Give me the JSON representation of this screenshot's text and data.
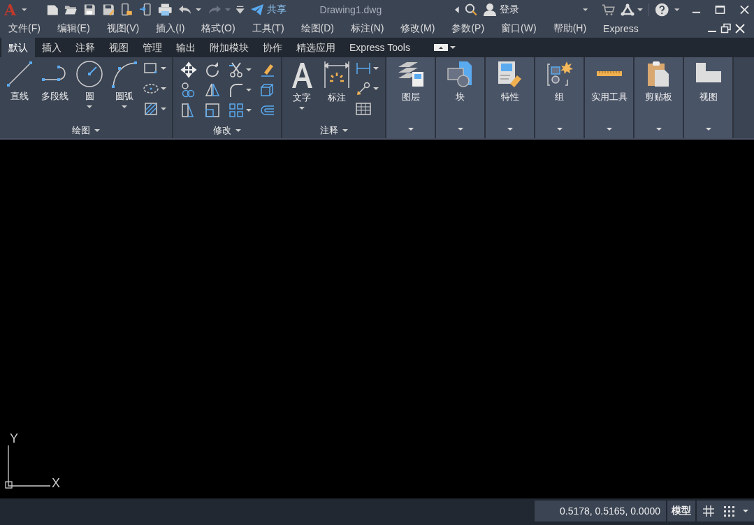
{
  "title_bar": {
    "logo": "A",
    "share": "共享",
    "document_title": "Drawing1.dwg",
    "sign_in": "登录"
  },
  "menu_bar": {
    "items": [
      "文件(F)",
      "编辑(E)",
      "视图(V)",
      "插入(I)",
      "格式(O)",
      "工具(T)",
      "绘图(D)",
      "标注(N)",
      "修改(M)",
      "参数(P)",
      "窗口(W)",
      "帮助(H)",
      "Express"
    ]
  },
  "ribbon": {
    "tabs": [
      {
        "label": "默认",
        "selected": true
      },
      {
        "label": "插入",
        "selected": false
      },
      {
        "label": "注释",
        "selected": false
      },
      {
        "label": "视图",
        "selected": false
      },
      {
        "label": "管理",
        "selected": false
      },
      {
        "label": "输出",
        "selected": false
      },
      {
        "label": "附加模块",
        "selected": false
      },
      {
        "label": "协作",
        "selected": false
      },
      {
        "label": "精选应用",
        "selected": false
      },
      {
        "label": "Express Tools",
        "selected": false
      }
    ],
    "panels": [
      {
        "kind": "tools",
        "title": "绘图",
        "tools": [
          {
            "label": "直线",
            "has_dropdown": false
          },
          {
            "label": "多段线",
            "has_dropdown": false
          },
          {
            "label": "圆",
            "has_dropdown": true
          },
          {
            "label": "圆弧",
            "has_dropdown": true
          }
        ]
      },
      {
        "kind": "grid",
        "title": "修改"
      },
      {
        "kind": "tools",
        "title": "注释",
        "tools": [
          {
            "label": "文字",
            "has_dropdown": true
          },
          {
            "label": "标注",
            "has_dropdown": false
          }
        ]
      },
      {
        "kind": "collapsed",
        "title": "图层"
      },
      {
        "kind": "collapsed",
        "title": "块"
      },
      {
        "kind": "collapsed",
        "title": "特性"
      },
      {
        "kind": "collapsed",
        "title": "组"
      },
      {
        "kind": "collapsed",
        "title": "实用工具"
      },
      {
        "kind": "collapsed",
        "title": "剪贴板"
      },
      {
        "kind": "collapsed",
        "title": "视图"
      }
    ]
  },
  "canvas": {
    "ucs": {
      "x_label": "X",
      "y_label": "Y"
    }
  },
  "status_bar": {
    "coordinates": "0.5178, 0.5165, 0.0000",
    "space": "模型"
  }
}
